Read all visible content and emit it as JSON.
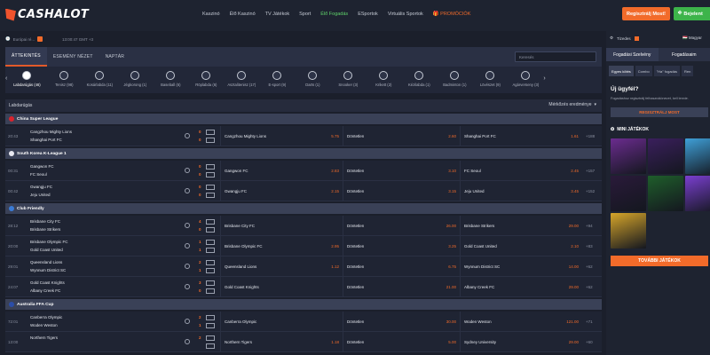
{
  "header": {
    "logo_text": "CASHALOT",
    "nav": [
      "Kaszinó",
      "Élő Kaszinó",
      "TV Játékok",
      "Sport",
      "Élő Fogadás",
      "ESportok",
      "Virtuális Sportok",
      "PROMÓCIÓK"
    ],
    "register": "Regisztrálj Most!",
    "login": "Bejelent"
  },
  "subbar": {
    "timezone": "Európai ré...",
    "clock": "13:00:47 GMT +3"
  },
  "tabs": {
    "items": [
      "ÁTTEKINTÉS",
      "ESEMÉNY NÉZET",
      "NAPTÁR"
    ],
    "search_placeholder": "Keresés"
  },
  "sports": [
    "Labdarúgás (46)",
    "Tenisz (98)",
    "Kosárlabda (11)",
    "Jégkorong (1)",
    "Baseball (6)",
    "Röplabda (6)",
    "Asztalitenisz (17)",
    "E-sport (9)",
    "Darts (1)",
    "Snooker (3)",
    "Krikett (2)",
    "Kézilabda (1)",
    "Badminton (1)",
    "Lövészet (9)",
    "Agárverseny (3)"
  ],
  "section": {
    "title": "Labdarúgás",
    "market": "Mérkőzés eredménye"
  },
  "leagues": [
    {
      "name": "China Super League",
      "color": "#d9232d",
      "matches": [
        {
          "time": "20:43",
          "home": "Cangzhou Mighty Lions",
          "away": "Shanghai Port FC",
          "s1": "0",
          "s2": "0",
          "o1n": "Cangzhou Mighty Lions",
          "o1": "5.75",
          "ox": "2.60",
          "o2n": "Shanghai Port FC",
          "o2": "1.61",
          "more": "+188"
        }
      ]
    },
    {
      "name": "South Korea K-League 1",
      "color": "#e8e8f0",
      "matches": [
        {
          "time": "00:31",
          "home": "Gangwon FC",
          "away": "FC Seoul",
          "s1": "0",
          "s2": "0",
          "o1n": "Gangwon FC",
          "o1": "2.83",
          "ox": "3.10",
          "o2n": "FC Seoul",
          "o2": "2.45",
          "more": "+157"
        },
        {
          "time": "00:42",
          "home": "Gwangju FC",
          "away": "Jeju United",
          "s1": "0",
          "s2": "0",
          "o1n": "Gwangju FC",
          "o1": "2.15",
          "ox": "3.15",
          "o2n": "Jeju United",
          "o2": "3.45",
          "more": "+152"
        }
      ]
    },
    {
      "name": "Club Friendly",
      "color": "#3a7bd5",
      "matches": [
        {
          "time": "28:12",
          "home": "Brisbane City FC",
          "away": "Brisbane Strikers",
          "s1": "4",
          "s2": "0",
          "o1n": "Brisbane City FC",
          "o1": "",
          "ox": "26.00",
          "o2n": "Brisbane Strikers",
          "o2": "29.00",
          "more": "+94"
        },
        {
          "time": "20:00",
          "home": "Brisbane Olympic FC",
          "away": "Gold Coast United",
          "s1": "1",
          "s2": "1",
          "o1n": "Brisbane Olympic FC",
          "o1": "2.95",
          "ox": "3.25",
          "o2n": "Gold Coast United",
          "o2": "2.10",
          "more": "+83"
        },
        {
          "time": "29:01",
          "home": "Queensland Lions",
          "away": "Wynnum District SC",
          "s1": "2",
          "s2": "1",
          "o1n": "Queensland Lions",
          "o1": "1.12",
          "ox": "6.75",
          "o2n": "Wynnum District SC",
          "o2": "14.00",
          "more": "+62"
        },
        {
          "time": "24:07",
          "home": "Gold Coast Knights",
          "away": "Albany Creek FC",
          "s1": "3",
          "s2": "0",
          "o1n": "Gold Coast Knights",
          "o1": "",
          "ox": "21.00",
          "o2n": "Albany Creek FC",
          "o2": "29.00",
          "more": "+62"
        }
      ]
    },
    {
      "name": "Australia FFA Cup",
      "color": "#2b4da8",
      "matches": [
        {
          "time": "72:01",
          "home": "Canberra Olympic",
          "away": "Woden Weston",
          "s1": "2",
          "s2": "1",
          "o1n": "Canberra Olympic",
          "o1": "",
          "ox": "30.00",
          "o2n": "Woden Weston",
          "o2": "121.00",
          "more": "+71"
        },
        {
          "time": "13:00",
          "home": "Northern Tigers",
          "away": "",
          "s1": "2",
          "s2": "",
          "o1n": "Northern Tigers",
          "o1": "1.18",
          "ox": "5.00",
          "o2n": "Sydney University",
          "o2": "29.00",
          "more": "+60"
        }
      ]
    }
  ],
  "draw_label": "Döntetlen",
  "right_panel": {
    "tipster": "Tizedes",
    "lang": "Magyar",
    "slip_tabs": [
      "Fogadási Szelvény",
      "Fogadásaim"
    ],
    "slip_types": [
      "Egyes kötés",
      "Combo",
      "\"Ha\" fogadás",
      "Ren"
    ],
    "new_user": "Új ügyfél?",
    "new_user_desc": "Fogadáshoz regisztrálj felhasználónevet, kell lennie.",
    "register": "REGISZTRÁLJ MOST",
    "mini_games": "MINI JÁTÉKOK",
    "more_games": "TOVÁBBI JÁTÉKOK",
    "game_colors": [
      "#6b2c8f",
      "#3a1f5c",
      "#3fa0d8",
      "#2a1a3a",
      "#1f5e2b",
      "#7a3fd0",
      "#d7a62a"
    ]
  }
}
